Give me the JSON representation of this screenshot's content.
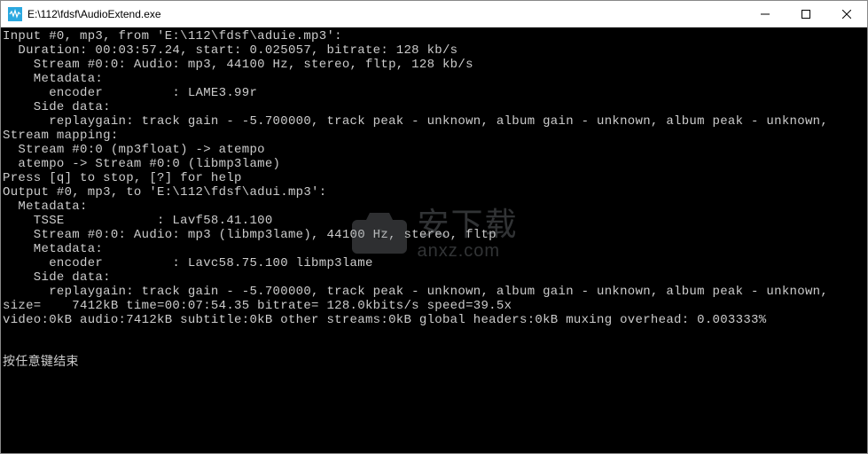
{
  "titlebar": {
    "path": "E:\\112\\fdsf\\AudioExtend.exe"
  },
  "console_lines": [
    "Input #0, mp3, from 'E:\\112\\fdsf\\aduie.mp3':",
    "  Duration: 00:03:57.24, start: 0.025057, bitrate: 128 kb/s",
    "    Stream #0:0: Audio: mp3, 44100 Hz, stereo, fltp, 128 kb/s",
    "    Metadata:",
    "      encoder         : LAME3.99r",
    "    Side data:",
    "      replaygain: track gain - -5.700000, track peak - unknown, album gain - unknown, album peak - unknown,",
    "Stream mapping:",
    "  Stream #0:0 (mp3float) -> atempo",
    "  atempo -> Stream #0:0 (libmp3lame)",
    "Press [q] to stop, [?] for help",
    "Output #0, mp3, to 'E:\\112\\fdsf\\adui.mp3':",
    "  Metadata:",
    "    TSSE            : Lavf58.41.100",
    "    Stream #0:0: Audio: mp3 (libmp3lame), 44100 Hz, stereo, fltp",
    "    Metadata:",
    "      encoder         : Lavc58.75.100 libmp3lame",
    "    Side data:",
    "      replaygain: track gain - -5.700000, track peak - unknown, album gain - unknown, album peak - unknown,",
    "size=    7412kB time=00:07:54.35 bitrate= 128.0kbits/s speed=39.5x",
    "video:0kB audio:7412kB subtitle:0kB other streams:0kB global headers:0kB muxing overhead: 0.003333%",
    "",
    "",
    "按任意键结束"
  ],
  "watermark": {
    "cn": "安下载",
    "en": "anxz.com"
  }
}
